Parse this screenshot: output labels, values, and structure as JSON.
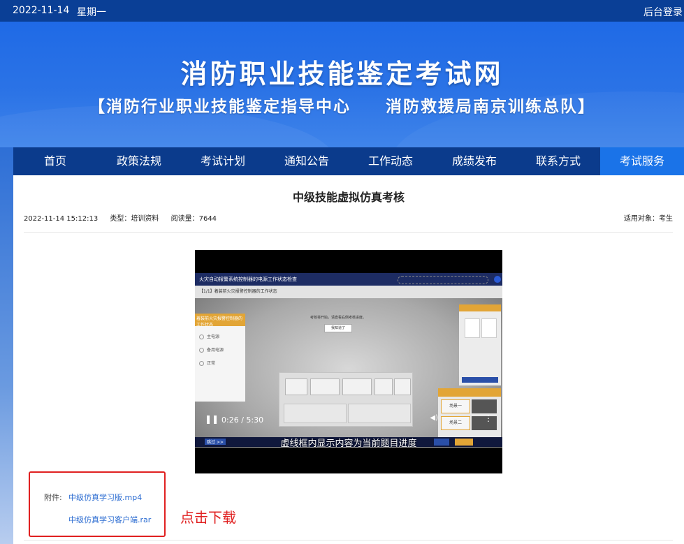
{
  "topbar": {
    "date": "2022-11-14",
    "weekday": "星期一",
    "login": "后台登录"
  },
  "banner": {
    "title": "消防职业技能鉴定考试网",
    "subtitle": "【消防行业职业技能鉴定指导中心　　消防救援局南京训练总队】"
  },
  "nav": {
    "items": [
      {
        "label": "首页"
      },
      {
        "label": "政策法规"
      },
      {
        "label": "考试计划"
      },
      {
        "label": "通知公告"
      },
      {
        "label": "工作动态"
      },
      {
        "label": "成绩发布"
      },
      {
        "label": "联系方式"
      },
      {
        "label": "考试服务"
      }
    ],
    "active_index": 7
  },
  "article": {
    "title": "中级技能虚拟仿真考核",
    "datetime": "2022-11-14 15:12:13",
    "type": "类型：培训资料",
    "reads": "阅读量：7644",
    "audience": "适用对象：考生"
  },
  "video": {
    "time": "0:26 / 5:30",
    "caption": "虚线框内显示内容为当前题目进度",
    "scene_header": "火灾自动报警系统控制器的电源工作状态检查",
    "scene_title": "【1/1】着装前火灾报警控制器的工作状态",
    "dialog_text": "考核将开始，请查看右侧考核进度。",
    "dialog_button": "我知道了",
    "left_panel_title": "着装前火灾报警控制器的工作状态",
    "left_options": [
      "主电源",
      "备用电源",
      "正常"
    ],
    "right_panel_items": [
      "场景一",
      "场景二"
    ],
    "bottom_left_label": "跳过 >>"
  },
  "attachments": {
    "label": "附件:",
    "files": [
      "中级仿真学习版.mp4",
      "中级仿真学习客户端.rar"
    ]
  },
  "annotation": {
    "text": "点击下载"
  },
  "colors": {
    "topbar": "#0a3f96",
    "nav": "#0b3b8c",
    "nav_active": "#1a73e8",
    "link": "#2a6bd1",
    "annotation": "#e02020"
  }
}
